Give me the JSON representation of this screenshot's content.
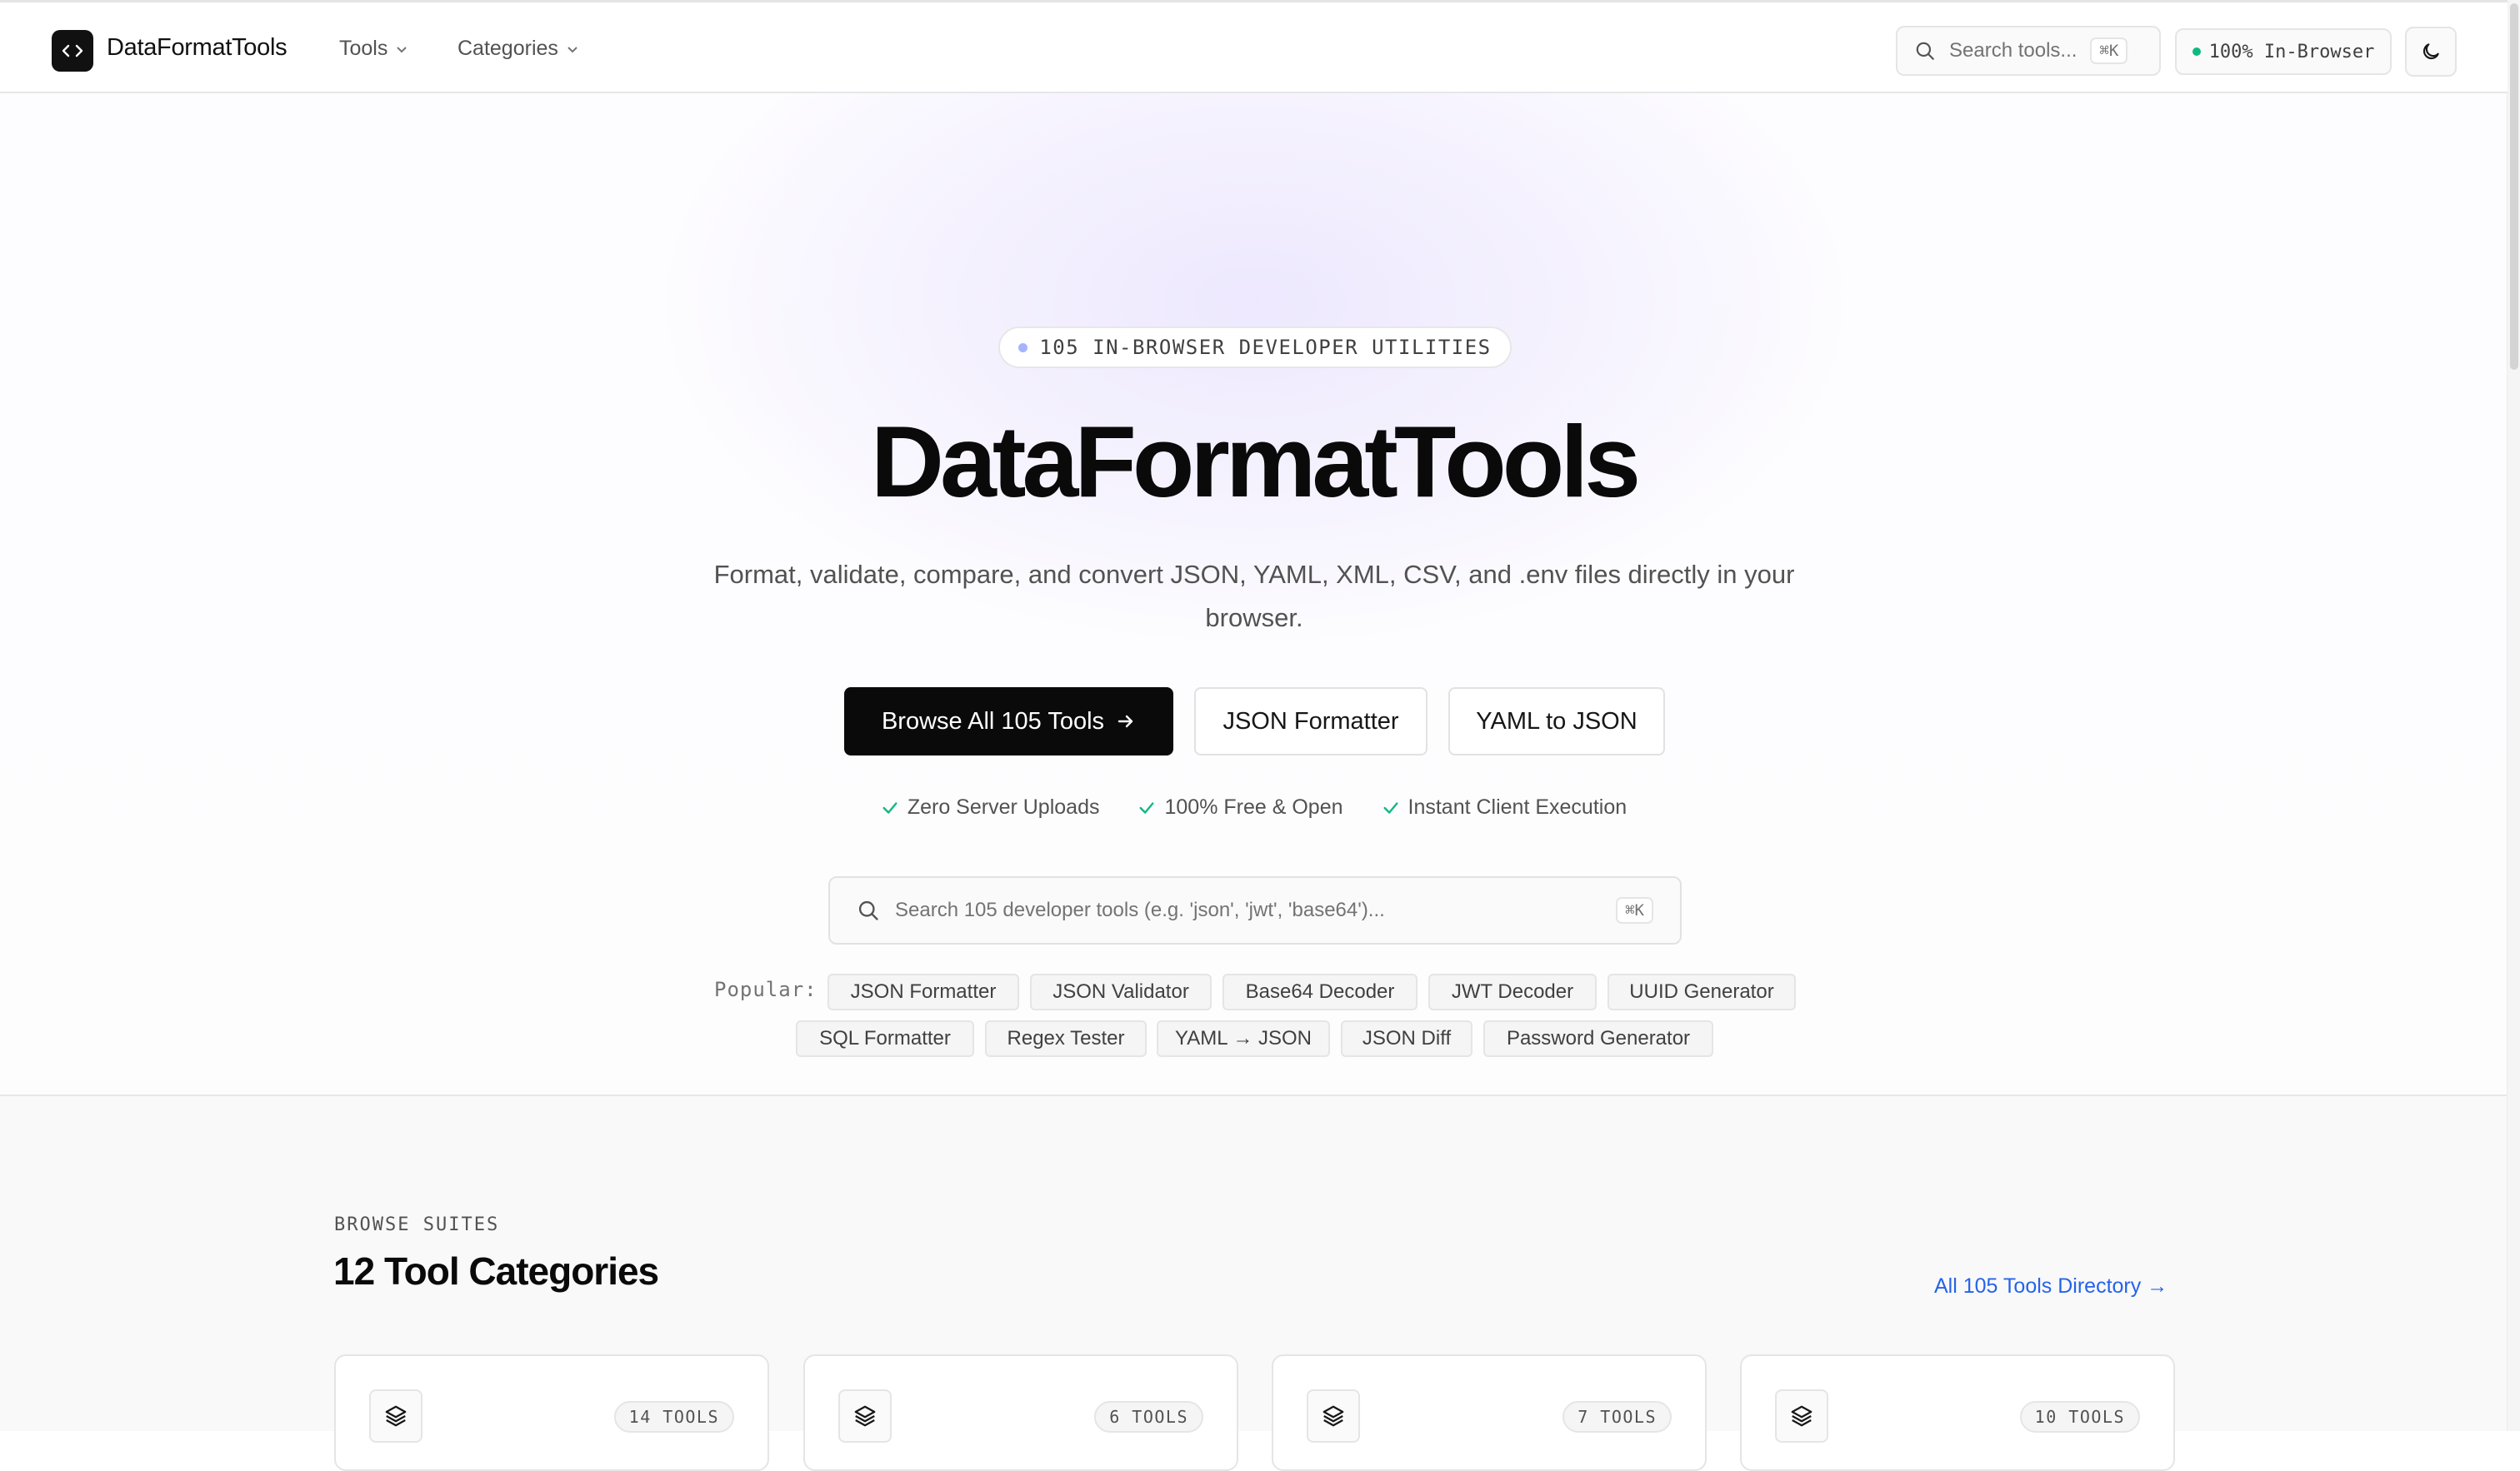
{
  "nav": {
    "brand": "DataFormatTools",
    "items": [
      {
        "label": "Tools"
      },
      {
        "label": "Categories"
      }
    ],
    "search_placeholder": "Search tools...",
    "search_shortcut": "⌘K",
    "badge": "100% In-Browser"
  },
  "hero": {
    "pill": "105 IN-BROWSER DEVELOPER UTILITIES",
    "title": "DataFormatTools",
    "subtitle": "Format, validate, compare, and convert JSON, YAML, XML, CSV, and .env files directly in your browser.",
    "primary_button": "Browse All 105 Tools",
    "secondary_buttons": [
      "JSON Formatter",
      "YAML to JSON"
    ],
    "checks": [
      "Zero Server Uploads",
      "100% Free & Open",
      "Instant Client Execution"
    ],
    "search_placeholder": "Search 105 developer tools (e.g. 'json', 'jwt', 'base64')...",
    "search_shortcut": "⌘K",
    "popular_label": "Popular:",
    "popular": [
      "JSON Formatter",
      "JSON Validator",
      "Base64 Decoder",
      "JWT Decoder",
      "UUID Generator",
      "SQL Formatter",
      "Regex Tester",
      "YAML → JSON",
      "JSON Diff",
      "Password Generator"
    ]
  },
  "categories": {
    "eyebrow": "BROWSE SUITES",
    "title": "12 Tool Categories",
    "link": "All 105 Tools Directory →",
    "cards": [
      {
        "count": "14 TOOLS"
      },
      {
        "count": "6 TOOLS"
      },
      {
        "count": "7 TOOLS"
      },
      {
        "count": "10 TOOLS"
      }
    ]
  },
  "colors": {
    "primary": "#0a0a0a",
    "link": "#2563eb",
    "check": "#10b981",
    "accent_glow": "#c4b5fd"
  }
}
